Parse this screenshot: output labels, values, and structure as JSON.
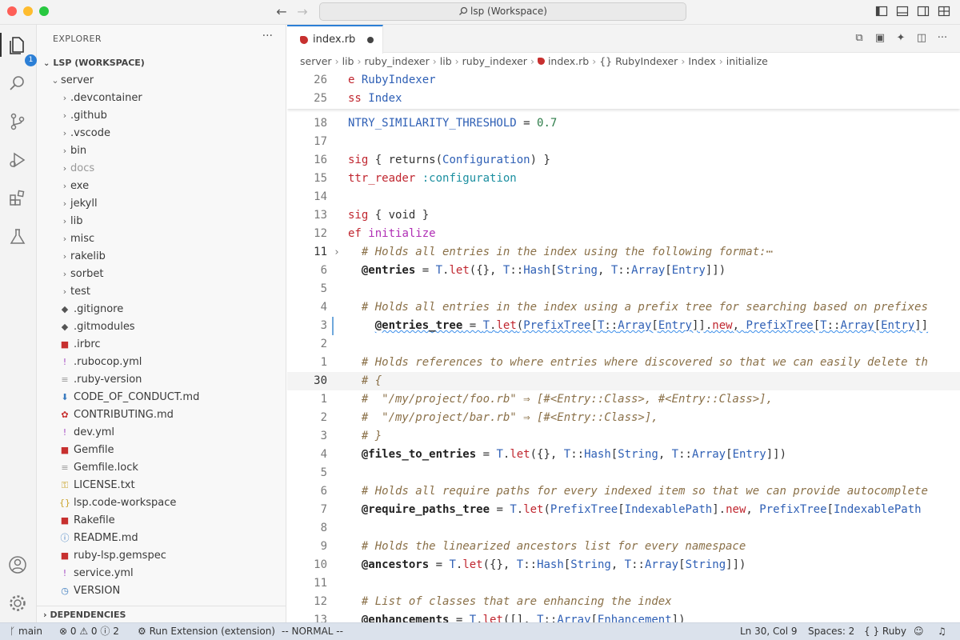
{
  "window": {
    "title": "lsp (Workspace)"
  },
  "activity_bar": {
    "explorer_badge": "1"
  },
  "explorer": {
    "header": "EXPLORER",
    "workspace": "LSP (WORKSPACE)",
    "root_folder": "server",
    "items": [
      {
        "label": ".devcontainer",
        "type": "folder"
      },
      {
        "label": ".github",
        "type": "folder"
      },
      {
        "label": ".vscode",
        "type": "folder"
      },
      {
        "label": "bin",
        "type": "folder"
      },
      {
        "label": "docs",
        "type": "folder",
        "dim": true
      },
      {
        "label": "exe",
        "type": "folder"
      },
      {
        "label": "jekyll",
        "type": "folder"
      },
      {
        "label": "lib",
        "type": "folder"
      },
      {
        "label": "misc",
        "type": "folder"
      },
      {
        "label": "rakelib",
        "type": "folder"
      },
      {
        "label": "sorbet",
        "type": "folder"
      },
      {
        "label": "test",
        "type": "folder"
      },
      {
        "label": ".gitignore",
        "type": "git"
      },
      {
        "label": ".gitmodules",
        "type": "git"
      },
      {
        "label": ".irbrc",
        "type": "ruby"
      },
      {
        "label": ".rubocop.yml",
        "type": "yml"
      },
      {
        "label": ".ruby-version",
        "type": "text"
      },
      {
        "label": "CODE_OF_CONDUCT.md",
        "type": "md-down"
      },
      {
        "label": "CONTRIBUTING.md",
        "type": "md-ribbon"
      },
      {
        "label": "dev.yml",
        "type": "yml"
      },
      {
        "label": "Gemfile",
        "type": "ruby"
      },
      {
        "label": "Gemfile.lock",
        "type": "text"
      },
      {
        "label": "LICENSE.txt",
        "type": "license"
      },
      {
        "label": "lsp.code-workspace",
        "type": "json"
      },
      {
        "label": "Rakefile",
        "type": "ruby"
      },
      {
        "label": "README.md",
        "type": "info"
      },
      {
        "label": "ruby-lsp.gemspec",
        "type": "ruby"
      },
      {
        "label": "service.yml",
        "type": "yml"
      },
      {
        "label": "VERSION",
        "type": "clock"
      }
    ],
    "dependencies": "DEPENDENCIES"
  },
  "editor": {
    "tab_label": "index.rb",
    "breadcrumb": [
      "server",
      "lib",
      "ruby_indexer",
      "lib",
      "ruby_indexer",
      "index.rb",
      "{} RubyIndexer",
      "Index",
      "initialize"
    ],
    "sticky_lines": [
      {
        "n": "26",
        "tokens": [
          {
            "t": "e ",
            "c": "kw"
          },
          {
            "t": "RubyIndexer",
            "c": "cls"
          }
        ]
      },
      {
        "n": "25",
        "tokens": [
          {
            "t": "ss ",
            "c": "kw"
          },
          {
            "t": "Index",
            "c": "cls"
          }
        ]
      }
    ],
    "lines": [
      {
        "n": "18",
        "tokens": [
          {
            "t": "NTRY_SIMILARITY_THRESHOLD",
            "c": "cls"
          },
          {
            "t": " = ",
            "c": ""
          },
          {
            "t": "0.7",
            "c": "num"
          }
        ]
      },
      {
        "n": "17",
        "tokens": []
      },
      {
        "n": "16",
        "tokens": [
          {
            "t": "sig",
            "c": "kw"
          },
          {
            "t": " { returns(",
            "c": ""
          },
          {
            "t": "Configuration",
            "c": "cls"
          },
          {
            "t": ") }",
            "c": ""
          }
        ]
      },
      {
        "n": "15",
        "tokens": [
          {
            "t": "ttr_reader",
            "c": "kw"
          },
          {
            "t": " ",
            "c": ""
          },
          {
            "t": ":configuration",
            "c": "sym"
          }
        ]
      },
      {
        "n": "14",
        "tokens": []
      },
      {
        "n": "13",
        "tokens": [
          {
            "t": "sig",
            "c": "kw"
          },
          {
            "t": " { void }",
            "c": ""
          }
        ]
      },
      {
        "n": "12",
        "tokens": [
          {
            "t": "ef",
            "c": "kw"
          },
          {
            "t": " ",
            "c": ""
          },
          {
            "t": "initialize",
            "c": "fn"
          }
        ]
      },
      {
        "n": "11",
        "fold": true,
        "cur": true,
        "tokens": [
          {
            "t": "  # Holds all entries in the index using the following format:⋯",
            "c": "cmt"
          }
        ]
      },
      {
        "n": "6",
        "tokens": [
          {
            "t": "  ",
            "c": ""
          },
          {
            "t": "@entries",
            "c": "ivar"
          },
          {
            "t": " = ",
            "c": ""
          },
          {
            "t": "T",
            "c": "cls"
          },
          {
            "t": ".",
            "c": ""
          },
          {
            "t": "let",
            "c": "kw"
          },
          {
            "t": "({}, ",
            "c": ""
          },
          {
            "t": "T",
            "c": "cls"
          },
          {
            "t": "::",
            "c": ""
          },
          {
            "t": "Hash",
            "c": "cls"
          },
          {
            "t": "[",
            "c": ""
          },
          {
            "t": "String",
            "c": "cls"
          },
          {
            "t": ", ",
            "c": ""
          },
          {
            "t": "T",
            "c": "cls"
          },
          {
            "t": "::",
            "c": ""
          },
          {
            "t": "Array",
            "c": "cls"
          },
          {
            "t": "[",
            "c": ""
          },
          {
            "t": "Entry",
            "c": "cls"
          },
          {
            "t": "]])",
            "c": ""
          }
        ]
      },
      {
        "n": "5",
        "tokens": []
      },
      {
        "n": "4",
        "tokens": [
          {
            "t": "  # Holds all entries in the index using a prefix tree for searching based on prefixes",
            "c": "cmt"
          }
        ]
      },
      {
        "n": "3",
        "mod": true,
        "squig": true,
        "tokens": [
          {
            "t": "    ",
            "c": ""
          },
          {
            "t": "@entries_tree",
            "c": "ivar"
          },
          {
            "t": " = ",
            "c": ""
          },
          {
            "t": "T",
            "c": "cls"
          },
          {
            "t": ".",
            "c": ""
          },
          {
            "t": "let",
            "c": "kw"
          },
          {
            "t": "(",
            "c": ""
          },
          {
            "t": "PrefixTree",
            "c": "cls"
          },
          {
            "t": "[",
            "c": ""
          },
          {
            "t": "T",
            "c": "cls"
          },
          {
            "t": "::",
            "c": ""
          },
          {
            "t": "Array",
            "c": "cls"
          },
          {
            "t": "[",
            "c": ""
          },
          {
            "t": "Entry",
            "c": "cls"
          },
          {
            "t": "]].",
            "c": ""
          },
          {
            "t": "new",
            "c": "kw"
          },
          {
            "t": ", ",
            "c": ""
          },
          {
            "t": "PrefixTree",
            "c": "cls"
          },
          {
            "t": "[",
            "c": ""
          },
          {
            "t": "T",
            "c": "cls"
          },
          {
            "t": "::",
            "c": ""
          },
          {
            "t": "Array",
            "c": "cls"
          },
          {
            "t": "[",
            "c": ""
          },
          {
            "t": "Entry",
            "c": "cls"
          },
          {
            "t": "]]",
            "c": ""
          }
        ]
      },
      {
        "n": "2",
        "tokens": []
      },
      {
        "n": "1",
        "tokens": [
          {
            "t": "  # Holds references to where entries where discovered so that we can easily delete th",
            "c": "cmt"
          }
        ]
      },
      {
        "n": "30",
        "cur": true,
        "curline": true,
        "tokens": [
          {
            "t": "  # {",
            "c": "cmt"
          }
        ]
      },
      {
        "n": "1",
        "tokens": [
          {
            "t": "  #  \"/my/project/foo.rb\" ⇒ [#<Entry::Class>, #<Entry::Class>],",
            "c": "cmt"
          }
        ]
      },
      {
        "n": "2",
        "tokens": [
          {
            "t": "  #  \"/my/project/bar.rb\" ⇒ [#<Entry::Class>],",
            "c": "cmt"
          }
        ]
      },
      {
        "n": "3",
        "tokens": [
          {
            "t": "  # }",
            "c": "cmt"
          }
        ]
      },
      {
        "n": "4",
        "tokens": [
          {
            "t": "  ",
            "c": ""
          },
          {
            "t": "@files_to_entries",
            "c": "ivar"
          },
          {
            "t": " = ",
            "c": ""
          },
          {
            "t": "T",
            "c": "cls"
          },
          {
            "t": ".",
            "c": ""
          },
          {
            "t": "let",
            "c": "kw"
          },
          {
            "t": "({}, ",
            "c": ""
          },
          {
            "t": "T",
            "c": "cls"
          },
          {
            "t": "::",
            "c": ""
          },
          {
            "t": "Hash",
            "c": "cls"
          },
          {
            "t": "[",
            "c": ""
          },
          {
            "t": "String",
            "c": "cls"
          },
          {
            "t": ", ",
            "c": ""
          },
          {
            "t": "T",
            "c": "cls"
          },
          {
            "t": "::",
            "c": ""
          },
          {
            "t": "Array",
            "c": "cls"
          },
          {
            "t": "[",
            "c": ""
          },
          {
            "t": "Entry",
            "c": "cls"
          },
          {
            "t": "]])",
            "c": ""
          }
        ]
      },
      {
        "n": "5",
        "tokens": []
      },
      {
        "n": "6",
        "tokens": [
          {
            "t": "  # Holds all require paths for every indexed item so that we can provide autocomplete",
            "c": "cmt"
          }
        ]
      },
      {
        "n": "7",
        "tokens": [
          {
            "t": "  ",
            "c": ""
          },
          {
            "t": "@require_paths_tree",
            "c": "ivar"
          },
          {
            "t": " = ",
            "c": ""
          },
          {
            "t": "T",
            "c": "cls"
          },
          {
            "t": ".",
            "c": ""
          },
          {
            "t": "let",
            "c": "kw"
          },
          {
            "t": "(",
            "c": ""
          },
          {
            "t": "PrefixTree",
            "c": "cls"
          },
          {
            "t": "[",
            "c": ""
          },
          {
            "t": "IndexablePath",
            "c": "cls"
          },
          {
            "t": "].",
            "c": ""
          },
          {
            "t": "new",
            "c": "kw"
          },
          {
            "t": ", ",
            "c": ""
          },
          {
            "t": "PrefixTree",
            "c": "cls"
          },
          {
            "t": "[",
            "c": ""
          },
          {
            "t": "IndexablePath",
            "c": "cls"
          }
        ]
      },
      {
        "n": "8",
        "tokens": []
      },
      {
        "n": "9",
        "tokens": [
          {
            "t": "  # Holds the linearized ancestors list for every namespace",
            "c": "cmt"
          }
        ]
      },
      {
        "n": "10",
        "tokens": [
          {
            "t": "  ",
            "c": ""
          },
          {
            "t": "@ancestors",
            "c": "ivar"
          },
          {
            "t": " = ",
            "c": ""
          },
          {
            "t": "T",
            "c": "cls"
          },
          {
            "t": ".",
            "c": ""
          },
          {
            "t": "let",
            "c": "kw"
          },
          {
            "t": "({}, ",
            "c": ""
          },
          {
            "t": "T",
            "c": "cls"
          },
          {
            "t": "::",
            "c": ""
          },
          {
            "t": "Hash",
            "c": "cls"
          },
          {
            "t": "[",
            "c": ""
          },
          {
            "t": "String",
            "c": "cls"
          },
          {
            "t": ", ",
            "c": ""
          },
          {
            "t": "T",
            "c": "cls"
          },
          {
            "t": "::",
            "c": ""
          },
          {
            "t": "Array",
            "c": "cls"
          },
          {
            "t": "[",
            "c": ""
          },
          {
            "t": "String",
            "c": "cls"
          },
          {
            "t": "]])",
            "c": ""
          }
        ]
      },
      {
        "n": "11",
        "tokens": []
      },
      {
        "n": "12",
        "tokens": [
          {
            "t": "  # List of classes that are enhancing the index",
            "c": "cmt"
          }
        ]
      },
      {
        "n": "13",
        "tokens": [
          {
            "t": "  ",
            "c": ""
          },
          {
            "t": "@enhancements",
            "c": "ivar"
          },
          {
            "t": " = ",
            "c": ""
          },
          {
            "t": "T",
            "c": "cls"
          },
          {
            "t": ".",
            "c": ""
          },
          {
            "t": "let",
            "c": "kw"
          },
          {
            "t": "([], ",
            "c": ""
          },
          {
            "t": "T",
            "c": "cls"
          },
          {
            "t": "::",
            "c": ""
          },
          {
            "t": "Array",
            "c": "cls"
          },
          {
            "t": "[",
            "c": ""
          },
          {
            "t": "Enhancement",
            "c": "cls"
          },
          {
            "t": "])",
            "c": ""
          }
        ]
      }
    ]
  },
  "statusbar": {
    "branch": "main",
    "errors": "0",
    "warnings": "0",
    "infos": "2",
    "run": "Run Extension (extension)",
    "mode": "-- NORMAL --",
    "position": "Ln 30, Col 9",
    "spaces": "Spaces: 2",
    "language": "Ruby"
  },
  "colors": {
    "accent": "#2c7fd6",
    "ruby_red": "#c7302f",
    "statusbar_bg": "#dbe2ec"
  }
}
